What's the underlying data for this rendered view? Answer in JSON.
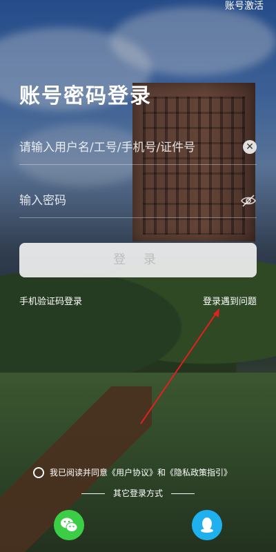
{
  "header": {
    "activate_label": "账号激活"
  },
  "title": "账号密码登录",
  "username": {
    "placeholder": "请输入用户名/工号/手机号/证件号",
    "value": ""
  },
  "password": {
    "placeholder": "输入密码",
    "value": ""
  },
  "login_button": "登 录",
  "links": {
    "sms_login": "手机验证码登录",
    "trouble": "登录遇到问题"
  },
  "agreement": {
    "text": "我已阅读并同意《用户协议》和《隐私政策指引》",
    "checked": false
  },
  "other_login": {
    "label": "其它登录方式",
    "providers": [
      "wechat",
      "qq"
    ]
  },
  "colors": {
    "wechat": "#3bcd45",
    "qq": "#1fb0f0",
    "annotation_arrow": "#e02020"
  },
  "icons": [
    "clear-icon",
    "eye-closed-icon",
    "wechat-icon",
    "qq-icon"
  ]
}
